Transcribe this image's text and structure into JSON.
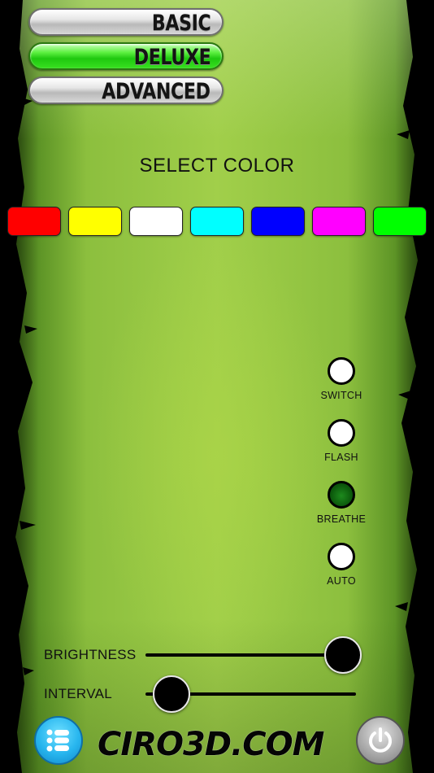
{
  "modes": {
    "items": [
      {
        "label": "BASIC",
        "active": false
      },
      {
        "label": "DELUXE",
        "active": true
      },
      {
        "label": "ADVANCED",
        "active": false
      }
    ]
  },
  "color_picker": {
    "title": "SELECT COLOR",
    "swatches": [
      "#ff0000",
      "#ffff00",
      "#ffffff",
      "#00ffff",
      "#0000ff",
      "#ff00ff",
      "#00ff00"
    ]
  },
  "effects": {
    "options": [
      {
        "label": "SWITCH",
        "selected": false
      },
      {
        "label": "FLASH",
        "selected": false
      },
      {
        "label": "BREATHE",
        "selected": true
      },
      {
        "label": "AUTO",
        "selected": false
      }
    ]
  },
  "sliders": {
    "brightness": {
      "label": "BRIGHTNESS",
      "value": 1.0
    },
    "interval": {
      "label": "INTERVAL",
      "value": 0.1
    }
  },
  "footer": {
    "brand": "CIRO3D.COM",
    "menu_icon": "list-menu-icon",
    "power_icon": "power-icon"
  }
}
